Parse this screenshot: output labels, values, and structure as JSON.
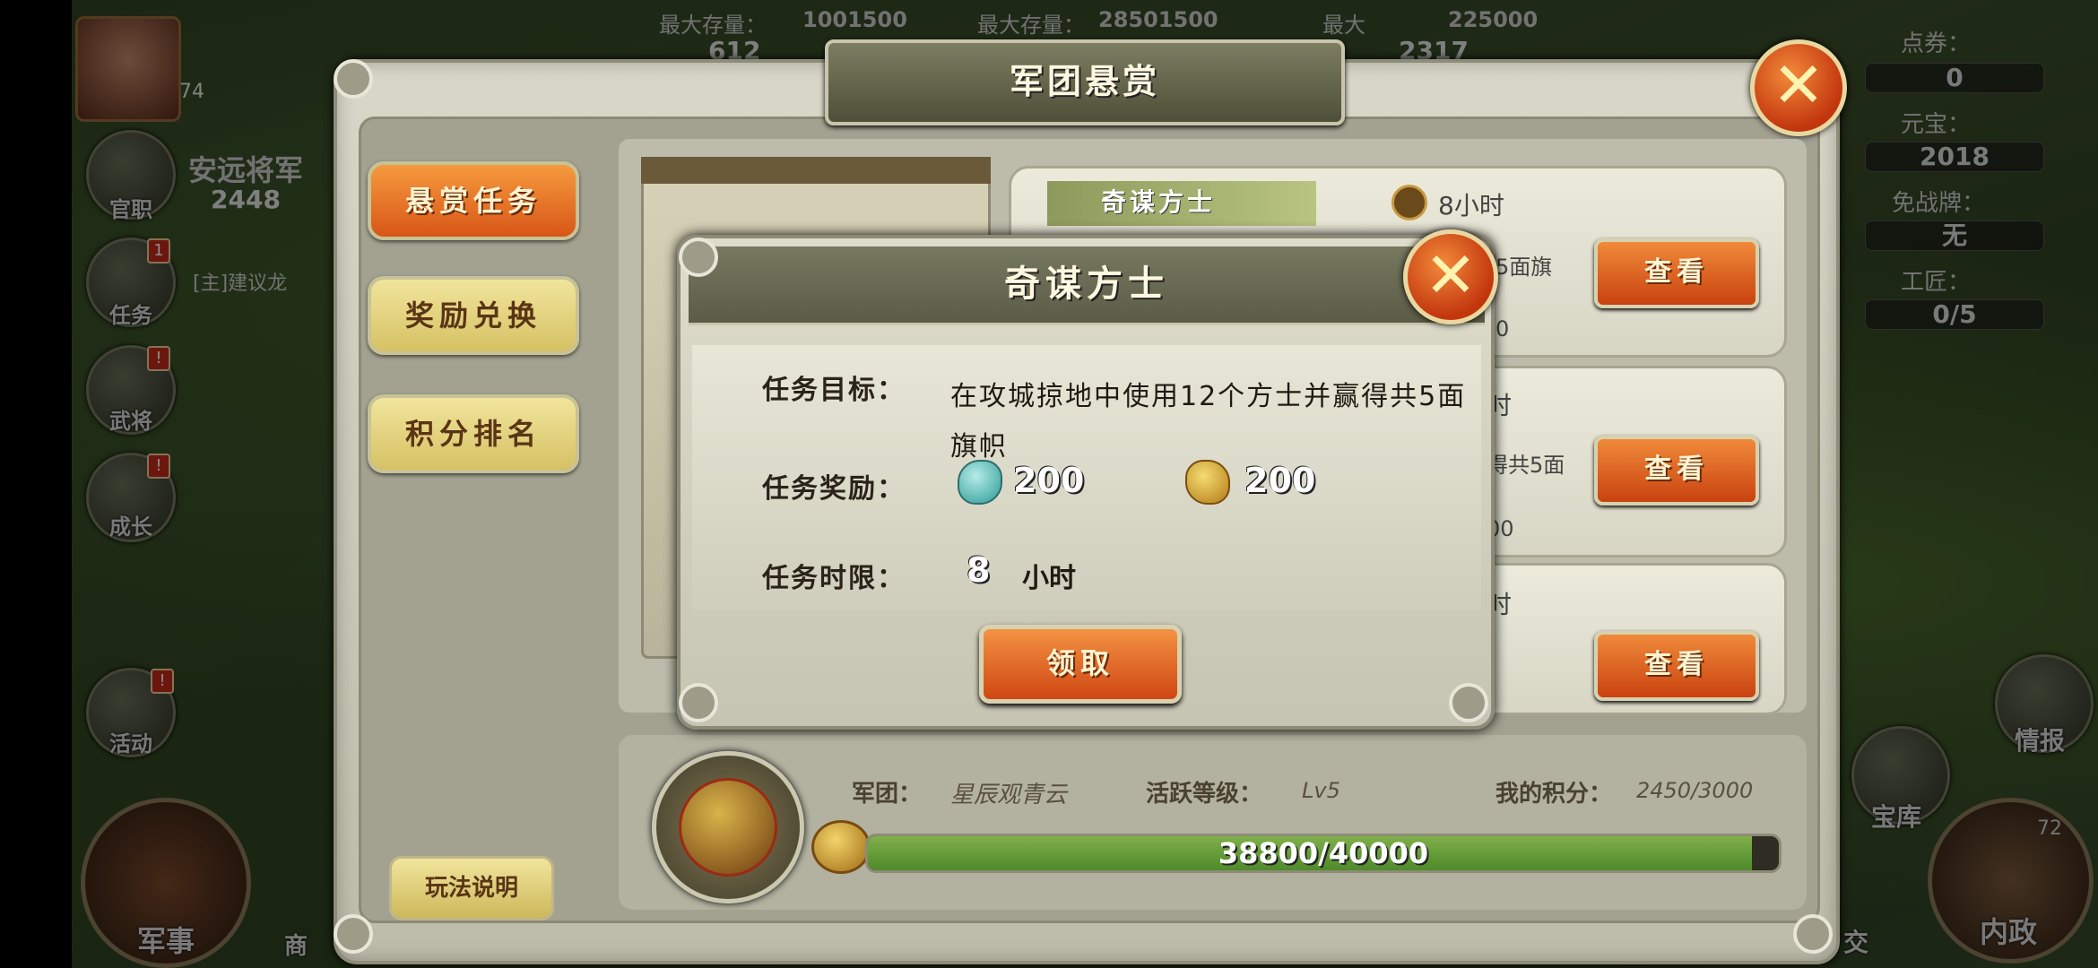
{
  "hud": {
    "storage_1_label": "最大存量：",
    "storage_1_value": "1001500",
    "storage_2_label": "最大存量：",
    "storage_2_value": "28501500",
    "storage_3_label": "最大",
    "storage_3_value": "225000",
    "res_1": "612",
    "res_2": "2317",
    "player_level": "74",
    "player_title": "安远将军",
    "player_power": "2448",
    "chat_line": "[主]建议龙",
    "right_labels": {
      "coupon": "点券：",
      "yuanbao": "元宝：",
      "exempt": "免战牌：",
      "worker": "工匠："
    },
    "right_values": {
      "coupon": "0",
      "yuanbao": "2018",
      "exempt": "无",
      "worker": "0/5"
    },
    "left_buttons": [
      {
        "label": "官职",
        "badge": ""
      },
      {
        "label": "任务",
        "badge": "1"
      },
      {
        "label": "武将",
        "badge": "!"
      },
      {
        "label": "成长",
        "badge": "!"
      },
      {
        "label": "活动",
        "badge": "!"
      }
    ],
    "bottom_left_label": "军事",
    "bottom_left_partial": "商",
    "bottom_right": [
      {
        "label": "情报"
      },
      {
        "label": "宝库"
      },
      {
        "label": "内政"
      },
      {
        "label": "交"
      }
    ],
    "inner_badge": "72"
  },
  "panel": {
    "title": "军团悬赏",
    "tabs": [
      {
        "label": "悬赏任务",
        "active": true
      },
      {
        "label": "奖励兑换",
        "active": false
      },
      {
        "label": "积分排名",
        "active": false
      }
    ],
    "help_label": "玩法说明",
    "tasks": [
      {
        "name": "奇谋方士",
        "time": "8小时",
        "desc_partial": "5面旗",
        "sub_partial": "0",
        "view_label": "查看"
      },
      {
        "name": "",
        "time": "时",
        "desc_partial": "得共5面",
        "sub_partial": "00",
        "view_label": "查看"
      },
      {
        "name": "",
        "time": "时",
        "desc_partial": "",
        "sub_partial": "",
        "view_label": "查看"
      }
    ],
    "legion_label": "军团：",
    "legion_value": "星辰观青云",
    "active_label": "活跃等级：",
    "active_value": "Lv5",
    "points_label": "我的积分：",
    "points_value": "2450/3000",
    "progress_text": "38800/40000",
    "progress_fraction": 0.97
  },
  "dialog": {
    "title": "奇谋方士",
    "goal_label": "任务目标：",
    "goal_text": "在攻城掠地中使用12个方士并赢得共5面旗帜",
    "reward_label": "任务奖励：",
    "reward_1": "200",
    "reward_2": "200",
    "limit_label": "任务时限：",
    "limit_value": "8",
    "limit_unit": "小时",
    "claim_label": "领取"
  },
  "icons": {
    "close": "close-icon",
    "jade": "jade-reward-icon",
    "gold": "gold-ingot-icon",
    "clock": "clock-icon",
    "emblem": "legion-dragon-emblem"
  },
  "colors": {
    "accent_orange": "#d85617",
    "progress_green": "#5f9a34",
    "panel_bg": "#d9d7c8",
    "title_bar": "#5b5c46"
  }
}
